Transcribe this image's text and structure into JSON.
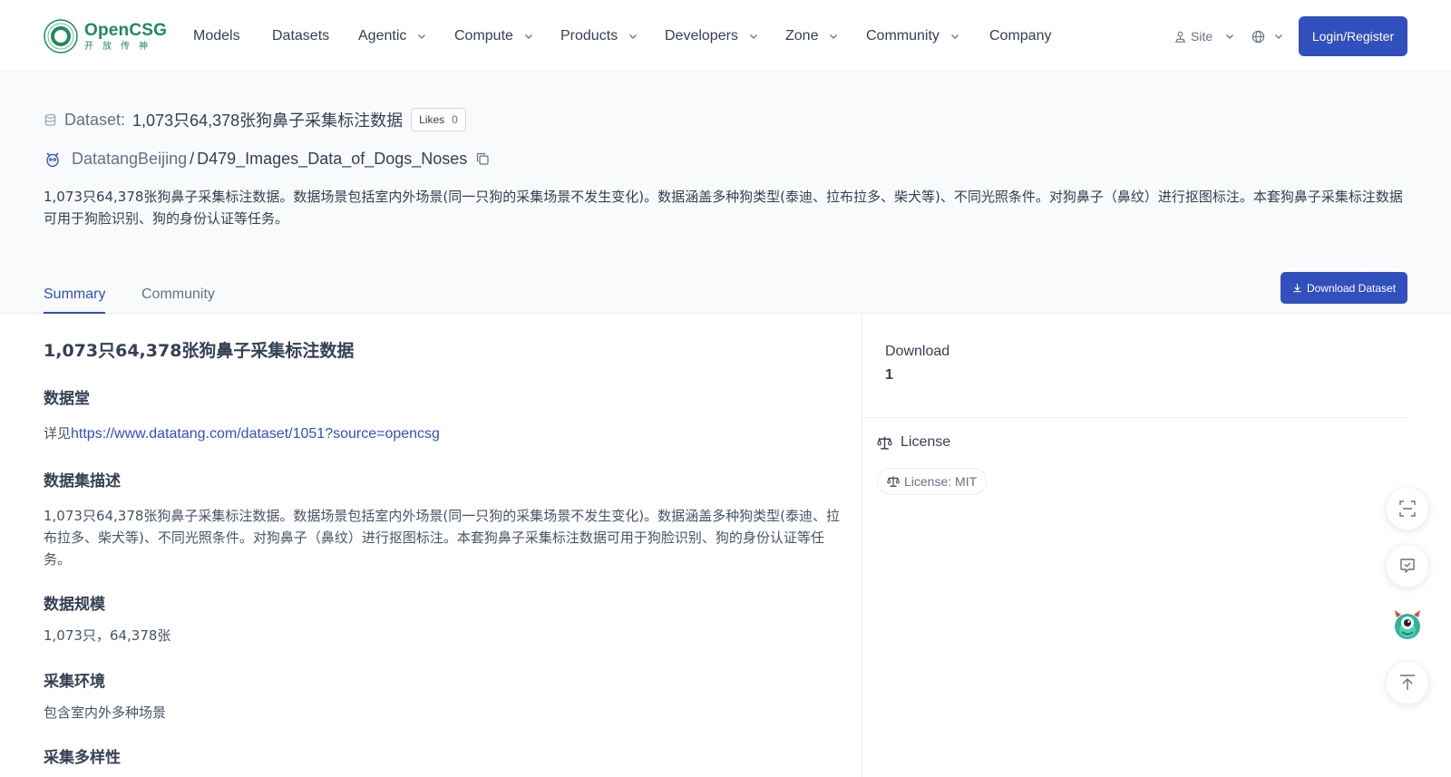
{
  "brand": {
    "name": "OpenCSG",
    "subtitle": "开放传神",
    "color": "#1f8a5b"
  },
  "nav": {
    "items": [
      {
        "label": "Models",
        "has_dropdown": false
      },
      {
        "label": "Datasets",
        "has_dropdown": false
      },
      {
        "label": "Agentic",
        "has_dropdown": true
      },
      {
        "label": "Compute",
        "has_dropdown": true
      },
      {
        "label": "Products",
        "has_dropdown": true
      },
      {
        "label": "Developers",
        "has_dropdown": true
      },
      {
        "label": "Zone",
        "has_dropdown": true
      },
      {
        "label": "Community",
        "has_dropdown": true
      },
      {
        "label": "Company",
        "has_dropdown": false
      }
    ],
    "site_label": "Site",
    "login_label": "Login/Register"
  },
  "dataset": {
    "type_label": "Dataset:",
    "title": "1,073只64,378张狗鼻子采集标注数据",
    "likes_label": "Likes",
    "likes_count": "0",
    "owner": "DatatangBeijing",
    "separator": "/",
    "repo": "D479_Images_Data_of_Dogs_Noses",
    "description": "1,073只64,378张狗鼻子采集标注数据。数据场景包括室内外场景(同一只狗的采集场景不发生变化)。数据涵盖多种狗类型(泰迪、拉布拉多、柴犬等)、不同光照条件。对狗鼻子（鼻纹）进行抠图标注。本套狗鼻子采集标注数据可用于狗脸识别、狗的身份认证等任务。"
  },
  "tabs": [
    {
      "label": "Summary",
      "active": true
    },
    {
      "label": "Community",
      "active": false
    }
  ],
  "download_button_label": "Download Dataset",
  "readme": {
    "h1": "1,073只64,378张狗鼻子采集标注数据",
    "sections": [
      {
        "heading": "数据堂",
        "prefix": "详见",
        "link": "https://www.datatang.com/dataset/1051?source=opencsg"
      },
      {
        "heading": "数据集描述",
        "text": "1,073只64,378张狗鼻子采集标注数据。数据场景包括室内外场景(同一只狗的采集场景不发生变化)。数据涵盖多种狗类型(泰迪、拉布拉多、柴犬等)、不同光照条件。对狗鼻子（鼻纹）进行抠图标注。本套狗鼻子采集标注数据可用于狗脸识别、狗的身份认证等任务。"
      },
      {
        "heading": "数据规模",
        "text": "1,073只，64,378张"
      },
      {
        "heading": "采集环境",
        "text": "包含室内外多种场景"
      },
      {
        "heading": "采集多样性"
      }
    ]
  },
  "sidebar": {
    "download_label": "Download",
    "download_count": "1",
    "license_heading": "License",
    "license_badge": "License: MIT"
  },
  "floating_buttons": [
    {
      "icon": "scan-icon"
    },
    {
      "icon": "check-square-icon"
    },
    {
      "icon": "mascot-icon"
    },
    {
      "icon": "back-to-top-icon"
    }
  ],
  "colors": {
    "primary": "#3250bd",
    "link": "#3250bd",
    "text": "#344054",
    "muted": "#667085",
    "brand": "#1f8a5b"
  }
}
